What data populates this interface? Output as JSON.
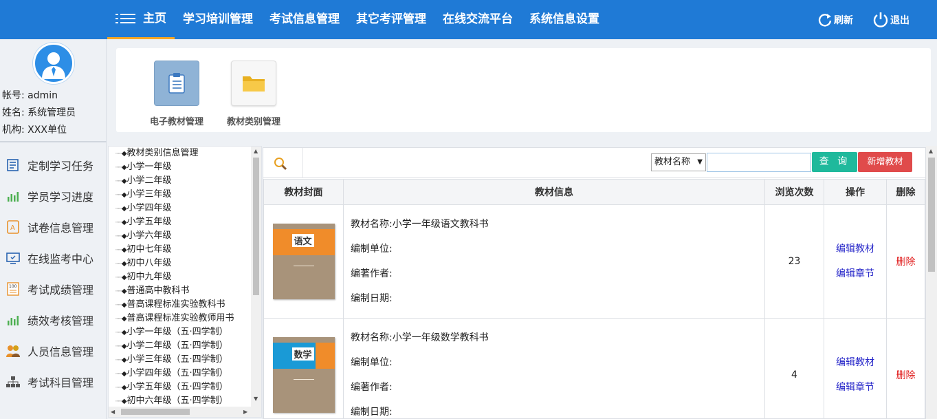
{
  "header": {
    "nav": [
      {
        "label": "主页"
      },
      {
        "label": "学习培训管理"
      },
      {
        "label": "考试信息管理"
      },
      {
        "label": "其它考评管理"
      },
      {
        "label": "在线交流平台"
      },
      {
        "label": "系统信息设置"
      }
    ],
    "refresh_label": "刷新",
    "logout_label": "退出"
  },
  "user": {
    "account": "帐号: admin",
    "name": "姓名: 系统管理员",
    "org": "机构: XXX单位"
  },
  "sidebar": {
    "items": [
      {
        "label": "定制学习任务",
        "icon": "task-list-icon"
      },
      {
        "label": "学员学习进度",
        "icon": "bar-chart-icon"
      },
      {
        "label": "试卷信息管理",
        "icon": "exam-paper-icon"
      },
      {
        "label": "在线监考中心",
        "icon": "monitor-icon"
      },
      {
        "label": "考试成绩管理",
        "icon": "score-sheet-icon"
      },
      {
        "label": "绩效考核管理",
        "icon": "bar-chart-icon"
      },
      {
        "label": "人员信息管理",
        "icon": "people-icon"
      },
      {
        "label": "考试科目管理",
        "icon": "hierarchy-icon"
      }
    ]
  },
  "modules": [
    {
      "label": "电子教材管理",
      "icon": "clipboard-icon"
    },
    {
      "label": "教材类别管理",
      "icon": "folder-icon"
    }
  ],
  "tree": {
    "items": [
      "教材类别信息管理",
      "小学一年级",
      "小学二年级",
      "小学三年级",
      "小学四年级",
      "小学五年级",
      "小学六年级",
      "初中七年级",
      "初中八年级",
      "初中九年级",
      "普通高中教科书",
      "普高课程标准实验教科书",
      "普高课程标准实验教师用书",
      "小学一年级（五·四学制）",
      "小学二年级（五·四学制）",
      "小学三年级（五·四学制）",
      "小学四年级（五·四学制）",
      "小学五年级（五·四学制）",
      "初中六年级（五·四学制）"
    ]
  },
  "toolbar": {
    "search_field": "教材名称",
    "search_value": "",
    "query_label": "查 询",
    "add_label": "新增教材"
  },
  "table": {
    "headers": {
      "cover": "教材封面",
      "info": "教材信息",
      "views": "浏览次数",
      "ops": "操作",
      "del": "删除"
    },
    "rows": [
      {
        "name": "教材名称:小学一年级语文教科书",
        "unit": "编制单位:",
        "author": "编著作者:",
        "date": "编制日期:",
        "views": "23",
        "edit_label": "编辑教材",
        "chapter_label": "编辑章节",
        "delete_label": "删除",
        "cover_title": "语文",
        "cover_color": "#f08c2a"
      },
      {
        "name": "教材名称:小学一年级数学教科书",
        "unit": "编制单位:",
        "author": "编著作者:",
        "date": "编制日期:",
        "views": "4",
        "edit_label": "编辑教材",
        "chapter_label": "编辑章节",
        "delete_label": "删除",
        "cover_title": "数学",
        "cover_color": "#1a9ad6"
      }
    ]
  },
  "colors": {
    "topbar": "#1f7ad6",
    "accent": "#f6a623",
    "query_button": "#1fb99c",
    "add_button": "#e04b4b",
    "link": "#2727c9",
    "delete_link": "#e01b1b"
  }
}
